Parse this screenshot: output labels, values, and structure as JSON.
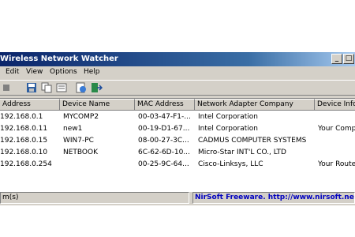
{
  "app": {
    "title": "Wireless Network Watcher",
    "minimize_glyph": "_",
    "maximize_glyph": "□"
  },
  "menu": [
    "Edit",
    "View",
    "Options",
    "Help"
  ],
  "toolbar": [
    "stop-icon",
    "save-icon",
    "copy-icon",
    "properties-icon",
    "html-report-icon",
    "exit-icon"
  ],
  "columns": [
    "Address",
    "Device Name",
    "MAC Address",
    "Network Adapter Company",
    "Device Info"
  ],
  "rows": [
    [
      "192.168.0.1",
      "MYCOMP2",
      "00-03-47-F1-...",
      "Intel Corporation",
      ""
    ],
    [
      "192.168.0.11",
      "new1",
      "00-19-D1-67...",
      "Intel Corporation",
      "Your Computer"
    ],
    [
      "192.168.0.15",
      "WIN7-PC",
      "08-00-27-3C...",
      "CADMUS COMPUTER SYSTEMS",
      ""
    ],
    [
      "192.168.0.10",
      "NETBOOK",
      "6C-62-6D-10...",
      "Micro-Star INT'L CO., LTD",
      ""
    ],
    [
      "192.168.0.254",
      "",
      "00-25-9C-64...",
      "Cisco-Linksys, LLC",
      "Your Router"
    ]
  ],
  "status": {
    "count": "m(s)",
    "credit": "NirSoft Freeware.  http://www.nirsoft.net"
  }
}
